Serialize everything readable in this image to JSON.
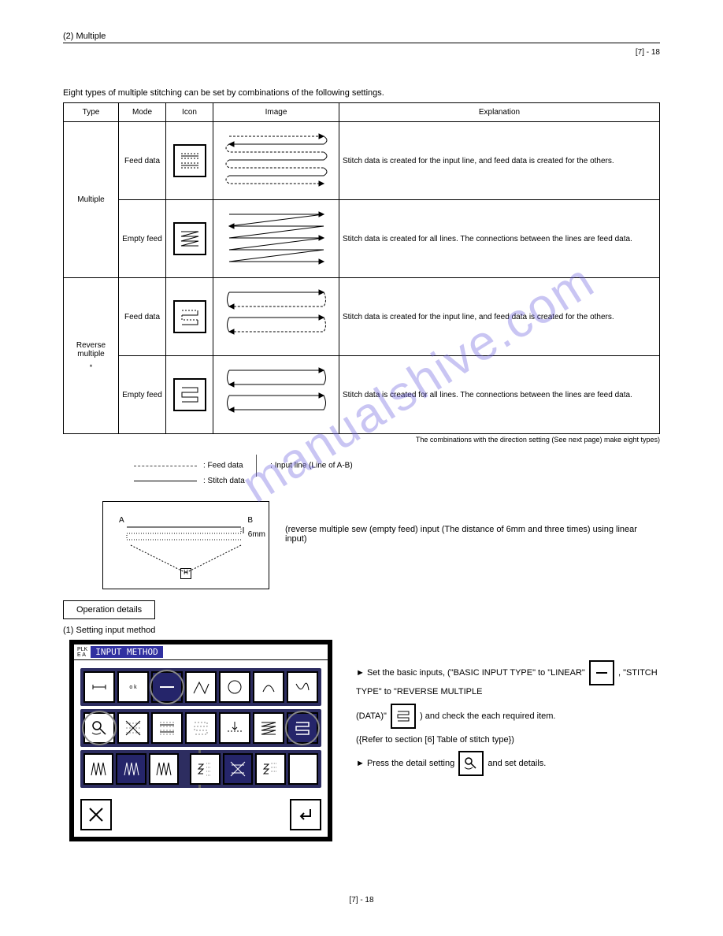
{
  "watermark": "manualshive.com",
  "header": {
    "title": "(2) Multiple",
    "page_section": "[7] - 18"
  },
  "intro": "Eight types of multiple stitching can be set by combinations of the following settings.",
  "table": {
    "headers": [
      "Type",
      "Mode",
      "Icon",
      "Image",
      "Explanation"
    ],
    "rows": [
      {
        "type": "Multiple",
        "mode": "Feed data",
        "icon": "multiple-feed-icon",
        "explanation": "Stitch data is created for the input line, and feed data is created for the others."
      },
      {
        "type": "Multiple",
        "mode": "Empty feed",
        "icon": "multiple-empty-icon",
        "explanation": "Stitch data is created for all lines. The connections between the lines are feed data."
      },
      {
        "type": "Reverse multiple",
        "mode": "Feed data",
        "icon": "reverse-feed-icon",
        "explanation": "Stitch data is created for the input line, and feed data is created for the others."
      },
      {
        "type": "Reverse multiple",
        "mode": "Empty feed",
        "icon": "reverse-empty-icon",
        "explanation": "Stitch data is created for all lines. The connections between the lines are feed data."
      }
    ],
    "note_star": "*",
    "note_combo": "The combinations with the direction setting (See next page) make eight types)"
  },
  "legend": {
    "dashed": ": Feed data",
    "solid": ": Stitch data",
    "input_line": ": Input line (Line of A-B)"
  },
  "example": {
    "A": "A",
    "B": "B",
    "six_mm": "6mm",
    "H": "H",
    "caption": "(reverse multiple sew (empty feed) input (The distance of 6mm and three times) using linear input)"
  },
  "procedure": {
    "label": "Operation details",
    "step_title": "(1) Setting input method",
    "screen_title": "INPUT METHOD",
    "bullet_1": "► Set the basic inputs, (\"BASIC INPUT TYPE\" to \"LINEAR\"",
    "bullet_1b": ", \"STITCH TYPE\" to \"REVERSE MULTIPLE",
    "bullet_1c": "(DATA)\"",
    "bullet_1d": ") and check the each required item.",
    "bullet_1e": "({Refer to section [6] Table of stitch type})",
    "bullet_2": "► Press the detail setting",
    "bullet_2b": "and set details.",
    "plk": "PLK",
    "ea": "E A"
  },
  "footer_page": "[7] - 18"
}
